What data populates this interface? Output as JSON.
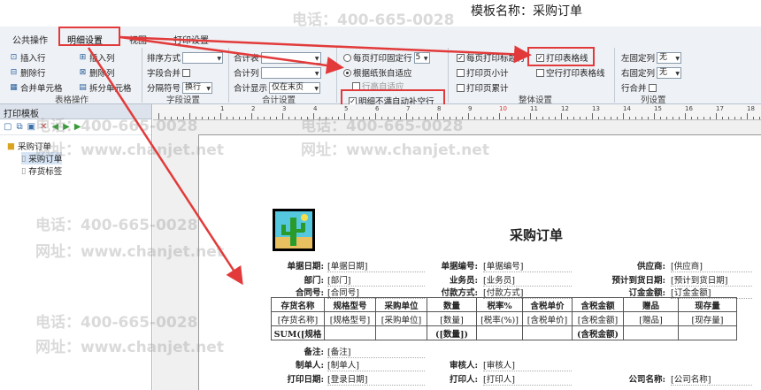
{
  "template_name": "模板名称：采购订单",
  "tabs": [
    "公共操作",
    "明细设置",
    "视图",
    "打印设置"
  ],
  "table_ops": {
    "insert_row": "插入行",
    "insert_col": "插入列",
    "delete_row": "删除行",
    "delete_col": "删除列",
    "merge_cells": "合并单元格",
    "split_cells": "拆分单元格",
    "group_label": "表格操作"
  },
  "field_settings": {
    "sort_label": "排序方式",
    "sort_value": "",
    "merge_label": "字段合并",
    "sep_label": "分隔符号",
    "sep_value": "换行",
    "group_label": "字段设置"
  },
  "total_settings": {
    "total_table": "合计表",
    "total_col": "合计列",
    "total_show": "合计显示",
    "total_show_value": "仅在末页",
    "group_label": "合计设置"
  },
  "page_rows": {
    "fixed_rows_label": "每页打印固定行",
    "fixed_rows_value": "5",
    "auto_fit_label": "根据纸张自适应",
    "row_height_label": "行高自适应",
    "fill_empty_label": "明细不满自动补空行"
  },
  "overall": {
    "print_title_rows": "每页打印标题行",
    "print_page_subtotal": "打印页小计",
    "print_page_cumulative": "打印页累计",
    "print_gridlines": "打印表格线",
    "empty_row_gridlines": "空行打印表格线",
    "group_label": "整体设置"
  },
  "col_settings": {
    "left_fixed": "左固定列",
    "left_value": "无",
    "right_fixed": "右固定列",
    "right_value": "无",
    "row_merge": "行合并",
    "group_label": "列设置"
  },
  "left_panel": {
    "title": "打印模板",
    "root": "采购订单",
    "children": [
      "采购订单",
      "存货标签"
    ]
  },
  "ruler_labels": [
    "1",
    "2",
    "3",
    "4",
    "5",
    "6",
    "7",
    "8",
    "9",
    "10",
    "11",
    "12",
    "13",
    "14",
    "15",
    "16",
    "17",
    "18",
    "19"
  ],
  "form": {
    "title": "采购订单",
    "rows": [
      [
        {
          "l": "单据日期:",
          "v": "[单据日期]"
        },
        {
          "l": "单据编号:",
          "v": "[单据编号]"
        },
        {
          "l": "供应商:",
          "v": "[供应商]"
        }
      ],
      [
        {
          "l": "部门:",
          "v": "[部门]"
        },
        {
          "l": "业务员:",
          "v": "[业务员]"
        },
        {
          "l": "预计到货日期:",
          "v": "[预计到货日期]"
        }
      ],
      [
        {
          "l": "合同号:",
          "v": "[合同号]"
        },
        {
          "l": "付款方式:",
          "v": "[付款方式]"
        },
        {
          "l": "订金金额:",
          "v": "[订金金额]"
        }
      ]
    ],
    "headers": [
      "存货名称",
      "规格型号",
      "采购单位",
      "数量",
      "税率%",
      "含税单价",
      "含税金额",
      "赠品",
      "现存量"
    ],
    "cells": [
      "[存货名称]",
      "[规格型号]",
      "[采购单位]",
      "[数量]",
      "[税率(%)]",
      "[含税单价]",
      "[含税金额]",
      "[赠品]",
      "[现存量]"
    ],
    "sum_row": [
      "SUM([规格",
      "",
      "",
      "([数量])",
      "",
      "",
      "(含税金额)",
      "",
      ""
    ],
    "remark_label": "备注:",
    "remark_value": "[备注]",
    "footer": [
      [
        {
          "l": "制单人:",
          "v": "[制单人]"
        },
        {
          "l": "审核人:",
          "v": "[审核人]"
        }
      ],
      [
        {
          "l": "打印日期:",
          "v": "[登录日期]"
        },
        {
          "l": "打印人:",
          "v": "[打印人]"
        },
        {
          "l": "公司名称:",
          "v": "[公司名称]"
        }
      ]
    ]
  },
  "watermark": {
    "phone": "电话：400-665-0028",
    "site": "网址：www.chanjet.net"
  },
  "colors": {
    "highlight": "#e23a3a",
    "ribbon": "#eef1f5"
  }
}
